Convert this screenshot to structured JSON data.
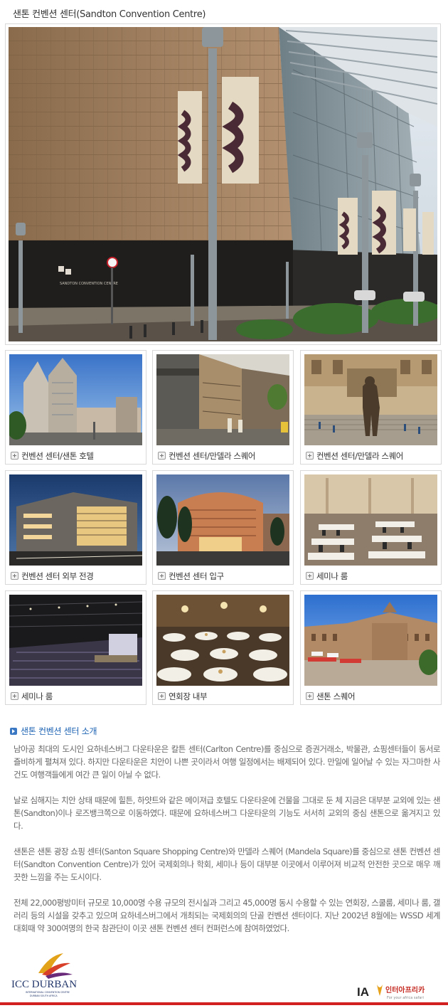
{
  "page": {
    "title": "샌톤 컨벤션 센터(Sandton Convention Centre)"
  },
  "hero": {
    "building_sign": "SANDTON CONVENTION CENTRE"
  },
  "gallery": [
    {
      "caption": "컨벤션 센터/샌톤 호텔"
    },
    {
      "caption": "컨벤션 센터/만델라 스퀘어"
    },
    {
      "caption": "컨벤션 센터/만델라 스퀘어"
    },
    {
      "caption": "컨벤션 센터 외부 전경"
    },
    {
      "caption": "컨벤션 센터 입구"
    },
    {
      "caption": "세미나 룸"
    },
    {
      "caption": "세미나 룸"
    },
    {
      "caption": "연회장 내부"
    },
    {
      "caption": "샌톤 스퀘어"
    }
  ],
  "intro": {
    "heading": "샌톤 컨벤션 센터 소개",
    "paragraphs": [
      "남아공 최대의 도시인 요하네스버그 다운타운은 칼튼 센터(Carlton Centre)를 중심으로 증권거래소, 박물관, 쇼핑센터들이 동서로 즐비하게 펼쳐져 있다. 하지만 다운타운은 치안이 나쁜 곳이라서 여행 일정에서는 배제되어 있다. 만일에 일어날 수 있는 자그마한 사건도 여행객들에게 여간 큰 일이 아닐 수 없다.",
      "날로 심해지는 치안 상태 때문에 힐튼, 하얏트와 같은 메이져급 호텔도 다운타운에 건물을 그대로 둔 체 지금은 대부분 교외에 있는 샌톤(Sandton)이나 로즈뱅크쪽으로 이동하였다. 때문에 요하네스버그 다운타운의 기능도 서서히 교외의 중심 샌톤으로 옮겨지고 있다.",
      "샌톤은 샌톤 광장 쇼핑 센터(Santon Square Shopping Centre)와 만델라 스퀘어 (Mandela Square)를 중심으로 샌톤 컨벤션 센터(Sandton Convention Centre)가 있어 국제회의나 학회, 세미나 등이 대부분 이곳에서 이루어져 비교적 안전한 곳으로 매우 깨끗한 느낌을 주는 도시이다.",
      "전체 22,000평방미터 규모로 10,000명 수용 규모의 전시실과 그리고 45,000명 동시 수용할 수 있는 연회장, 스쿨룸, 세미나 룸, 갤러리 등의 시설을 갖추고 있으며 요하네스버그에서 개최되는 국제회의의 단골 컨벤션 센터이다. 지난 2002년 8월에는 WSSD 세계대회때 약 300여명의 한국 참관단이 이곳 샌톤 컨벤션 센터 컨퍼런스에 참여하였었다."
    ]
  },
  "footer": {
    "icc_name": "ICC DURBAN",
    "icc_sub1": "INTERNATIONAL CONVENTION CENTRE",
    "icc_sub2": "DURBAN SOUTH AFRICA",
    "ia_mark": "IA",
    "ia_name": "인터아프리카",
    "ia_tagline": "For your africa safari"
  },
  "colors": {
    "accent_blue": "#1d63b3",
    "footer_red": "#d21f1f"
  }
}
